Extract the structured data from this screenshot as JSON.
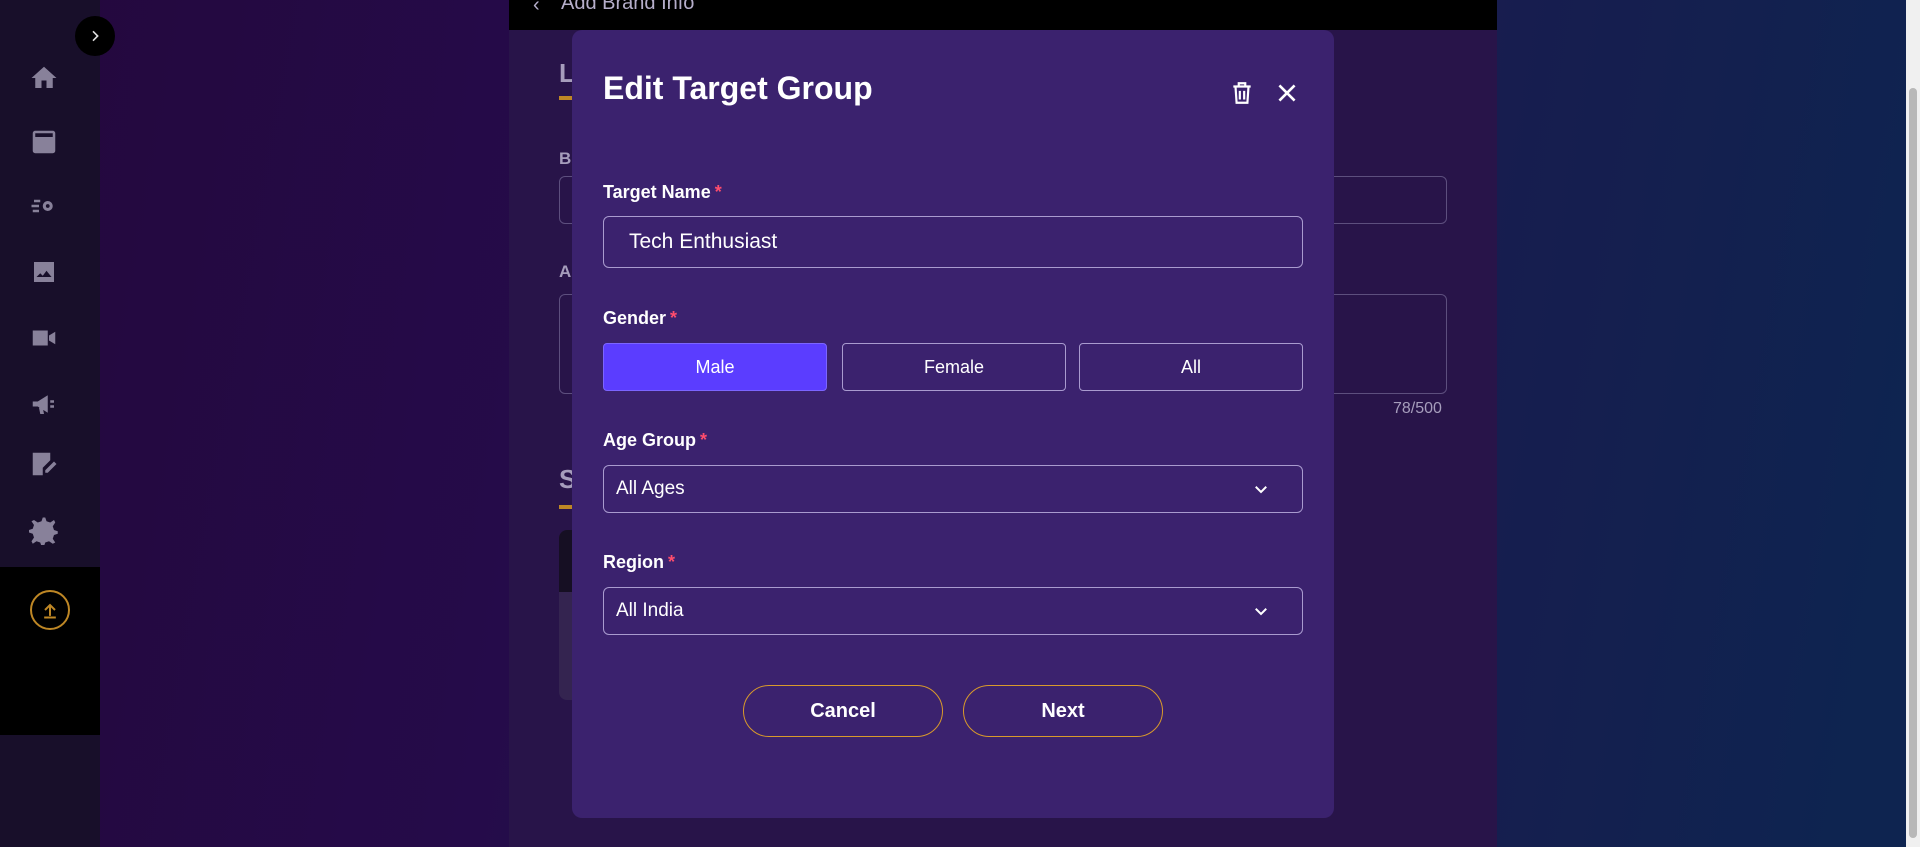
{
  "background": {
    "top_bar_title": "Add Brand Info",
    "section_letters": [
      "L",
      "B",
      "A",
      "S"
    ],
    "char_count": "78/500"
  },
  "sidebar": {
    "items": [
      {
        "icon": "home-icon"
      },
      {
        "icon": "archive-icon"
      },
      {
        "icon": "automation-gear-icon"
      },
      {
        "icon": "image-icon"
      },
      {
        "icon": "video-icon"
      },
      {
        "icon": "megaphone-icon"
      },
      {
        "icon": "edit-notes-icon"
      },
      {
        "icon": "settings-icon"
      }
    ],
    "upload_icon": "upload-icon",
    "toggle_icon": "chevron-right-icon"
  },
  "modal": {
    "title": "Edit Target Group",
    "target_name": {
      "label": "Target Name",
      "required_mark": "*",
      "value": "Tech Enthusiast"
    },
    "gender": {
      "label": "Gender",
      "required_mark": "*",
      "options": [
        "Male",
        "Female",
        "All"
      ],
      "selected": "Male"
    },
    "age_group": {
      "label": "Age Group",
      "required_mark": "*",
      "value": "All Ages"
    },
    "region": {
      "label": "Region",
      "required_mark": "*",
      "value": "All India"
    },
    "cancel_label": "Cancel",
    "next_label": "Next"
  },
  "colors": {
    "accent": "#5b3dff",
    "modal_bg": "#3b226e",
    "button_border": "#d99a2b",
    "required": "#ff4d6d"
  }
}
